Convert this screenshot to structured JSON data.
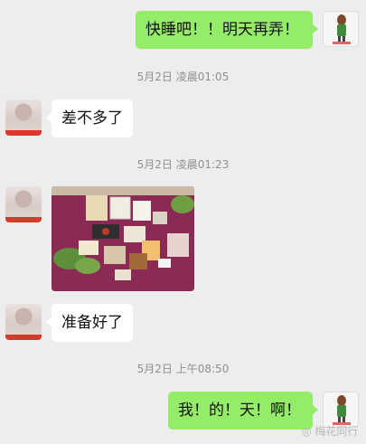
{
  "messages": [
    {
      "side": "right",
      "text": "快睡吧！！明天再弄！"
    },
    {
      "side": "left",
      "text": "差不多了"
    },
    {
      "side": "left",
      "type": "image",
      "description_hidden": ""
    },
    {
      "side": "left",
      "text": "准备好了"
    },
    {
      "side": "right",
      "text": "我！的！天！啊！"
    }
  ],
  "timestamps": [
    "5月2日 凌晨01:05",
    "5月2日 凌晨01:23",
    "5月2日 上午08:50"
  ],
  "watermark": {
    "text": "梅花同行"
  },
  "colors": {
    "background": "#ededed",
    "self_bubble": "#95ec69",
    "other_bubble": "#ffffff",
    "photo_mat": "#8a2a55"
  }
}
